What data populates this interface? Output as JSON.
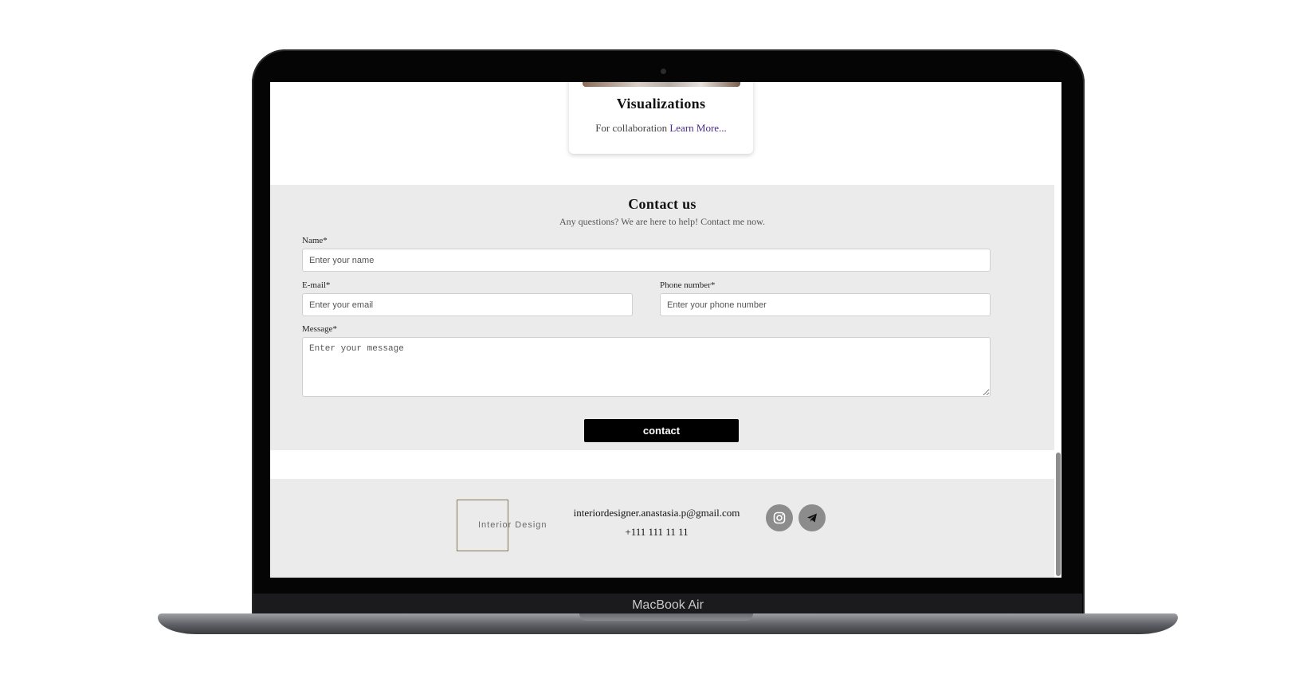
{
  "device": {
    "label": "MacBook Air"
  },
  "service_card": {
    "title": "Visualizations",
    "description": "For collaboration",
    "link_label": "Learn More..."
  },
  "contact": {
    "title": "Contact us",
    "subtitle": "Any questions? We are here to help! Contact me now.",
    "name_label": "Name*",
    "name_placeholder": "Enter your name",
    "email_label": "E-mail*",
    "email_placeholder": "Enter your email",
    "phone_label": "Phone number*",
    "phone_placeholder": "Enter your phone number",
    "message_label": "Message*",
    "message_placeholder": "Enter your message",
    "submit_label": "contact"
  },
  "footer": {
    "logo_text": "Interior Design",
    "email": "interiordesigner.anastasia.p@gmail.com",
    "phone": "+111 111 11 11",
    "socials": [
      {
        "icon": "instagram-icon"
      },
      {
        "icon": "telegram-icon"
      }
    ]
  }
}
